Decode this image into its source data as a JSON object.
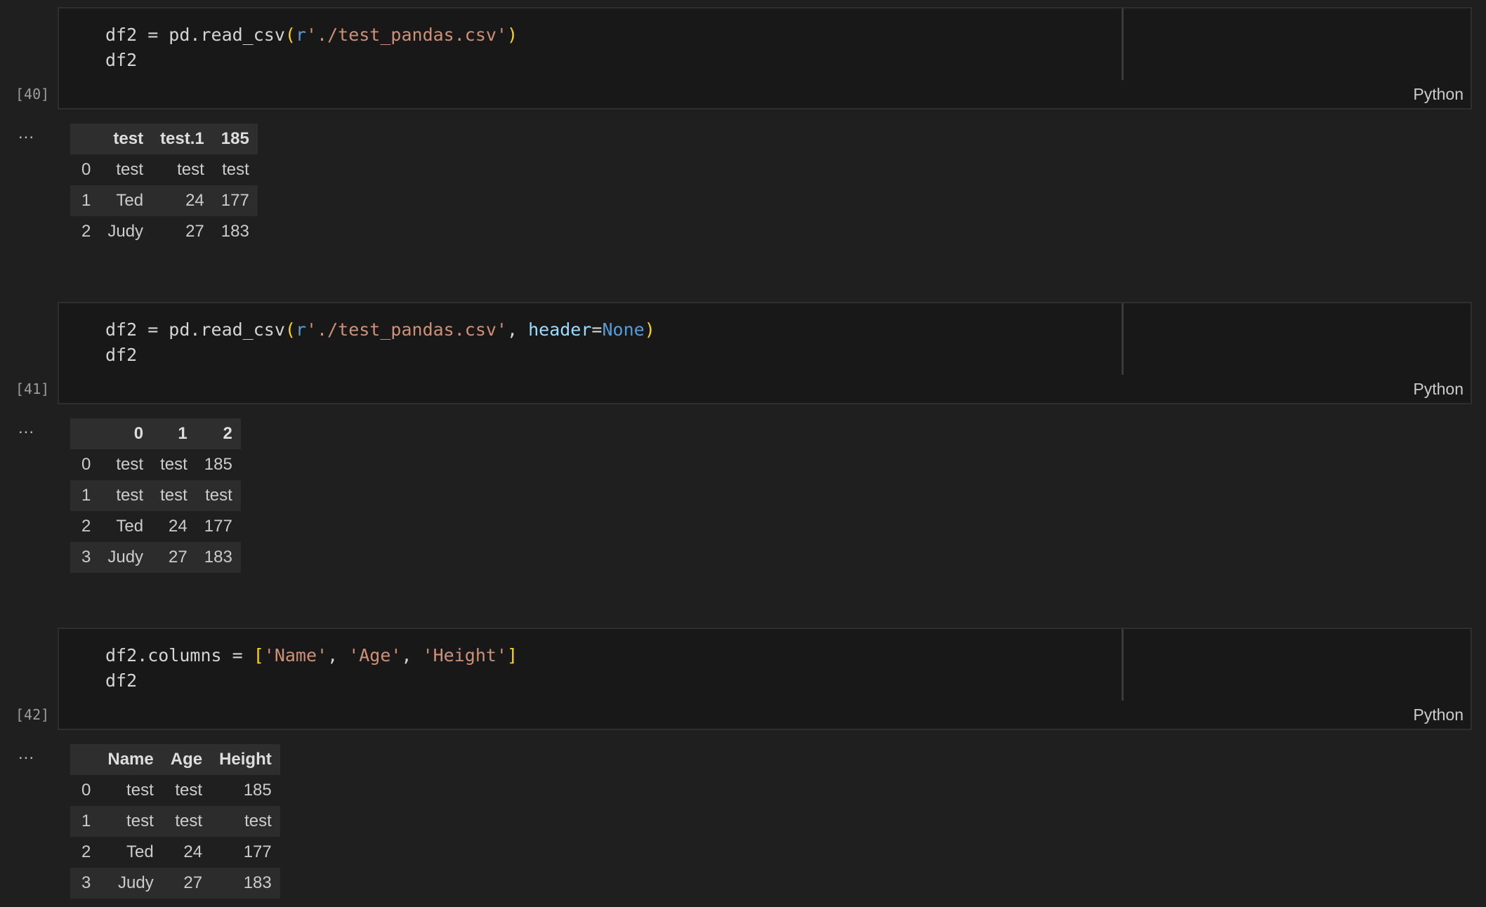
{
  "cells": [
    {
      "exec_count": "[40]",
      "language": "Python",
      "code": {
        "line1_a": "df2 = pd.read_csv(",
        "line1_r": "r",
        "line1_str": "'./test_pandas.csv'",
        "line1_close": ")",
        "line2": "df2"
      },
      "output_marker": "...",
      "table": {
        "columns": [
          "",
          "test",
          "test.1",
          "185"
        ],
        "rows": [
          [
            "0",
            "test",
            "test",
            "test"
          ],
          [
            "1",
            "Ted",
            "24",
            "177"
          ],
          [
            "2",
            "Judy",
            "27",
            "183"
          ]
        ]
      }
    },
    {
      "exec_count": "[41]",
      "language": "Python",
      "code": {
        "line1_a": "df2 = pd.read_csv(",
        "line1_r": "r",
        "line1_str": "'./test_pandas.csv'",
        "line1_comma": ", ",
        "line1_param": "header",
        "line1_eq": "=",
        "line1_kw": "None",
        "line1_close": ")",
        "line2": "df2"
      },
      "output_marker": "...",
      "table": {
        "columns": [
          "",
          "0",
          "1",
          "2"
        ],
        "rows": [
          [
            "0",
            "test",
            "test",
            "185"
          ],
          [
            "1",
            "test",
            "test",
            "test"
          ],
          [
            "2",
            "Ted",
            "24",
            "177"
          ],
          [
            "3",
            "Judy",
            "27",
            "183"
          ]
        ]
      }
    },
    {
      "exec_count": "[42]",
      "language": "Python",
      "code": {
        "line1_a": "df2.columns = ",
        "line1_open": "[",
        "line1_s1": "'Name'",
        "line1_c1": ", ",
        "line1_s2": "'Age'",
        "line1_c2": ", ",
        "line1_s3": "'Height'",
        "line1_close": "]",
        "line2": "df2"
      },
      "output_marker": "...",
      "table": {
        "columns": [
          "",
          "Name",
          "Age",
          "Height"
        ],
        "rows": [
          [
            "0",
            "test",
            "test",
            "185"
          ],
          [
            "1",
            "test",
            "test",
            "test"
          ],
          [
            "2",
            "Ted",
            "24",
            "177"
          ],
          [
            "3",
            "Judy",
            "27",
            "183"
          ]
        ]
      }
    }
  ]
}
